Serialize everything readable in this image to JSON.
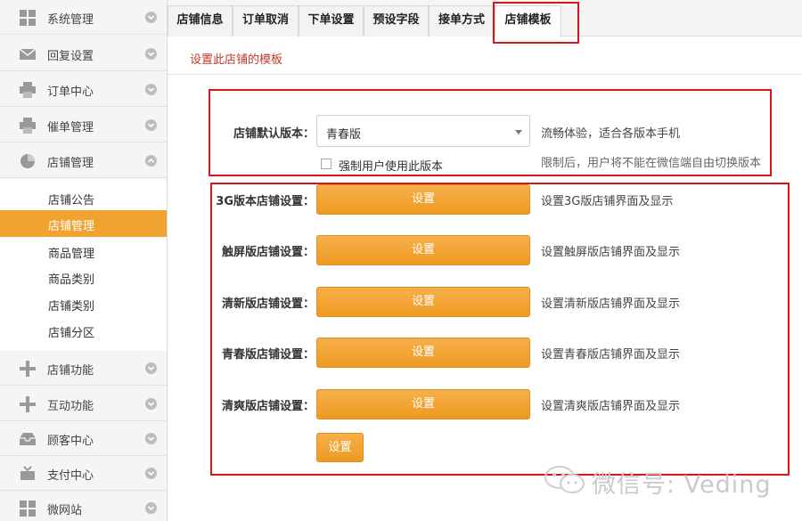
{
  "sidebar": {
    "items": [
      {
        "label": "系统管理",
        "icon": "grid-icon"
      },
      {
        "label": "回复设置",
        "icon": "envelope-icon"
      },
      {
        "label": "订单中心",
        "icon": "printer-icon"
      },
      {
        "label": "催单管理",
        "icon": "printer-icon"
      },
      {
        "label": "店铺管理",
        "icon": "pie-chart-icon"
      }
    ],
    "sub_items": [
      {
        "label": "店铺公告"
      },
      {
        "label": "店铺管理"
      },
      {
        "label": "商品管理"
      },
      {
        "label": "商品类别"
      },
      {
        "label": "店铺类别"
      },
      {
        "label": "店铺分区"
      }
    ],
    "bottom_items": [
      {
        "label": "店铺功能",
        "icon": "plus-icon"
      },
      {
        "label": "互动功能",
        "icon": "plus-icon"
      },
      {
        "label": "顾客中心",
        "icon": "inbox-icon"
      },
      {
        "label": "支付中心",
        "icon": "tray-icon"
      },
      {
        "label": "微网站",
        "icon": "grid-icon"
      }
    ]
  },
  "tabs": [
    {
      "label": "店铺信息"
    },
    {
      "label": "订单取消"
    },
    {
      "label": "下单设置"
    },
    {
      "label": "预设字段"
    },
    {
      "label": "接单方式"
    },
    {
      "label": "店铺模板"
    }
  ],
  "page": {
    "hint": "设置此店铺的模板"
  },
  "default_version": {
    "label": "店铺默认版本：",
    "selected": "青春版",
    "hint": "流畅体验，适合各版本手机",
    "force_label": "强制用户使用此版本",
    "force_hint": "限制后，用户将不能在微信端自由切换版本"
  },
  "settings": [
    {
      "label": "3G版本店铺设置：",
      "button": "设置",
      "hint": "设置3G版店铺界面及显示"
    },
    {
      "label": "触屏版店铺设置：",
      "button": "设置",
      "hint": "设置触屏版店铺界面及显示"
    },
    {
      "label": "清新版店铺设置：",
      "button": "设置",
      "hint": "设置清新版店铺界面及显示"
    },
    {
      "label": "青春版店铺设置：",
      "button": "设置",
      "hint": "设置青春版店铺界面及显示"
    },
    {
      "label": "清爽版店铺设置：",
      "button": "设置",
      "hint": "设置清爽版店铺界面及显示"
    }
  ],
  "save_button": "设置",
  "watermark": "微信号: Veding",
  "colors": {
    "accent": "#f0a330",
    "highlight": "#d9141b"
  }
}
